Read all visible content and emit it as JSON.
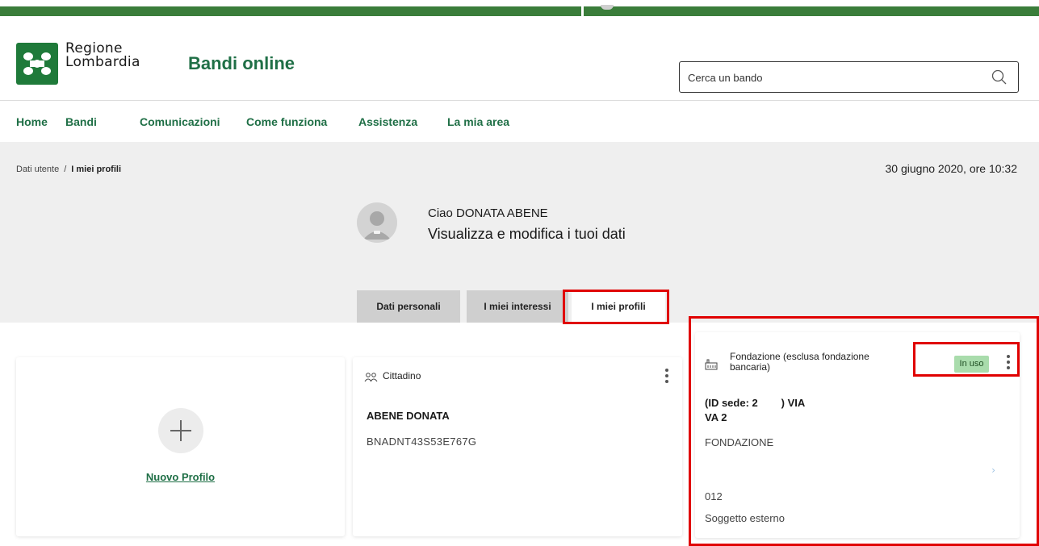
{
  "header": {
    "brand_line1": "Regione",
    "brand_line2": "Lombardia",
    "site_title": "Bandi online",
    "search_placeholder": "Cerca un bando",
    "brand_color": "#1f7a3a"
  },
  "nav": {
    "items": [
      {
        "label": "Home"
      },
      {
        "label": "Bandi"
      },
      {
        "label": "Comunicazioni"
      },
      {
        "label": "Come funziona"
      },
      {
        "label": "Assistenza"
      },
      {
        "label": "La mia area"
      }
    ]
  },
  "breadcrumb": {
    "items": [
      "Dati utente",
      "I miei profili"
    ],
    "separator": "/"
  },
  "datetime": "30 giugno 2020, ore 10:32",
  "user": {
    "greeting": "Ciao DONATA ABENE",
    "subtitle": "Visualizza e modifica i tuoi dati"
  },
  "tabs": [
    {
      "label": "Dati personali",
      "active": false
    },
    {
      "label": "I miei interessi",
      "active": false
    },
    {
      "label": "I miei profili",
      "active": true
    }
  ],
  "cards": {
    "new_profile": {
      "label": "Nuovo Profilo",
      "icon": "plus-icon"
    },
    "citizen": {
      "type": "Cittadino",
      "icon": "people-icon",
      "name": "ABENE DONATA",
      "code": "BNADNT43S53E767G"
    },
    "foundation": {
      "type": "Fondazione (esclusa fondazione bancaria)",
      "icon": "factory-icon",
      "status": "In uso",
      "address_line1": "(ID sede: 2        ) VIA",
      "address_line2": "VA 2",
      "entity": "FONDAZIONE",
      "code": "012",
      "role": "Soggetto esterno",
      "status_color": "#a9dcac"
    }
  },
  "accent_color": "#1f6f46",
  "highlight_color": "#e00000"
}
